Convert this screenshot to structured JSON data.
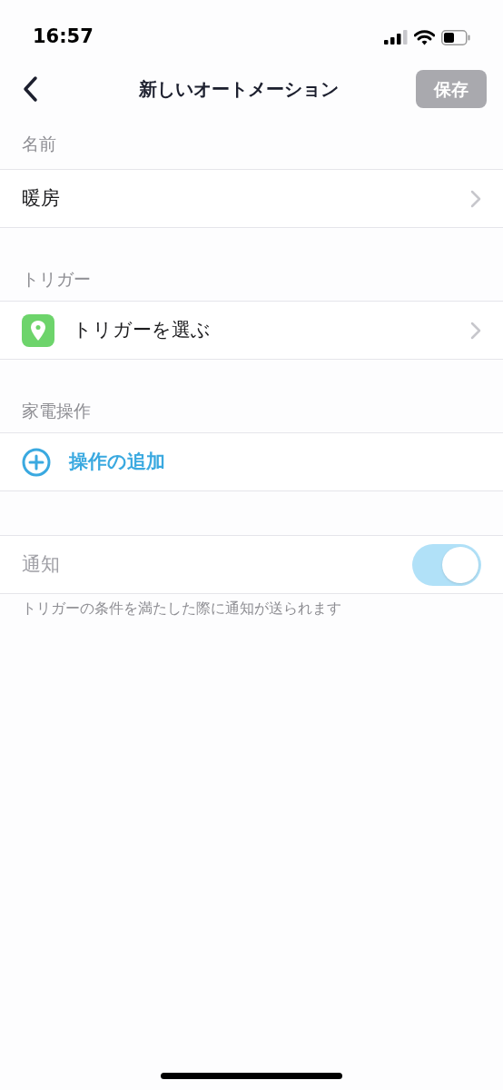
{
  "status_bar": {
    "time": "16:57"
  },
  "nav": {
    "title": "新しいオートメーション",
    "save_button": {
      "label": "保存",
      "disabled": true
    }
  },
  "sections": [
    {
      "header": "名前",
      "row": {
        "kind": "value",
        "label": "暖房"
      }
    },
    {
      "header": "トリガー",
      "row": {
        "kind": "trigger",
        "label": "トリガーを選ぶ"
      }
    },
    {
      "header": "家電操作",
      "row": {
        "kind": "add",
        "label": "操作の追加"
      }
    }
  ],
  "notification": {
    "label": "通知",
    "on": true,
    "disabled": true,
    "footnote": "トリガーの条件を満たした際に通知が送られます"
  }
}
